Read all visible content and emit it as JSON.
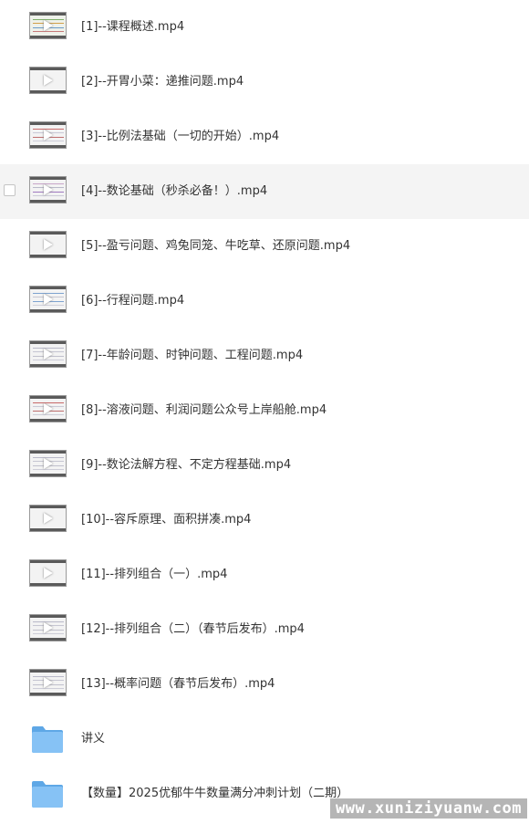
{
  "files": [
    {
      "name": "[1]--课程概述.mp4",
      "type": "video",
      "icon": "video-thumbnail-icon"
    },
    {
      "name": "[2]--开胃小菜：递推问题.mp4",
      "type": "video",
      "icon": "video-thumbnail-icon"
    },
    {
      "name": "[3]--比例法基础（一切的开始）.mp4",
      "type": "video",
      "icon": "video-thumbnail-icon"
    },
    {
      "name": "[4]--数论基础（秒杀必备！）.mp4",
      "type": "video",
      "icon": "video-thumbnail-icon",
      "hovered": true
    },
    {
      "name": "[5]--盈亏问题、鸡兔同笼、牛吃草、还原问题.mp4",
      "type": "video",
      "icon": "video-thumbnail-icon"
    },
    {
      "name": "[6]--行程问题.mp4",
      "type": "video",
      "icon": "video-thumbnail-icon"
    },
    {
      "name": "[7]--年龄问题、时钟问题、工程问题.mp4",
      "type": "video",
      "icon": "video-thumbnail-icon"
    },
    {
      "name": "[8]--溶液问题、利润问题公众号上岸船舱.mp4",
      "type": "video",
      "icon": "video-thumbnail-icon"
    },
    {
      "name": "[9]--数论法解方程、不定方程基础.mp4",
      "type": "video",
      "icon": "video-thumbnail-icon"
    },
    {
      "name": "[10]--容斥原理、面积拼凑.mp4",
      "type": "video",
      "icon": "video-thumbnail-icon"
    },
    {
      "name": "[11]--排列组合（一）.mp4",
      "type": "video",
      "icon": "video-thumbnail-icon"
    },
    {
      "name": "[12]--排列组合（二）（春节后发布）.mp4",
      "type": "video",
      "icon": "video-thumbnail-icon"
    },
    {
      "name": "[13]--概率问题（春节后发布）.mp4",
      "type": "video",
      "icon": "video-thumbnail-icon"
    },
    {
      "name": "讲义",
      "type": "folder",
      "icon": "folder-icon"
    },
    {
      "name": "【数量】2025优郁牛牛数量满分冲刺计划（二期）",
      "type": "folder",
      "icon": "folder-icon"
    }
  ],
  "watermark": "www.xuniziyuanw.com",
  "colors": {
    "row_hover": "#f4f4f4",
    "folder": "#6fb3ee",
    "text": "#333333"
  }
}
